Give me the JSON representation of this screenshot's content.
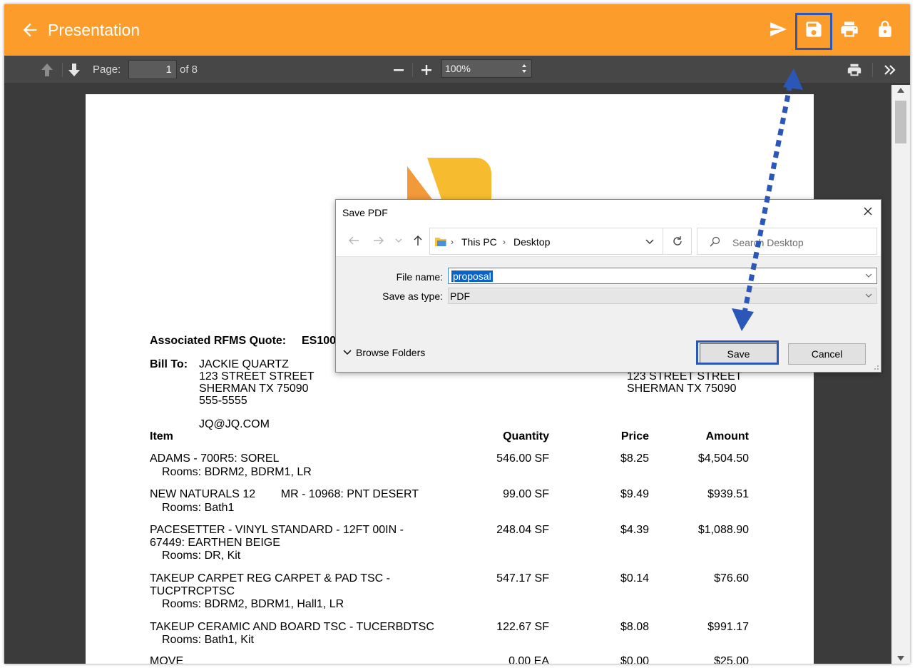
{
  "app": {
    "title": "Presentation",
    "accent_color": "#fc9c2b",
    "header_icons": [
      "send-icon",
      "save-icon",
      "print-icon",
      "lock-icon"
    ]
  },
  "pdf_toolbar": {
    "page_label": "Page:",
    "page_value": "1",
    "page_count": "of 8",
    "zoom_value": "100%"
  },
  "document": {
    "quote_label": "Associated RFMS Quote:",
    "quote_number_partial": "ES100",
    "bill_to_label": "Bill To:",
    "bill_to": [
      "JACKIE QUARTZ",
      "123 STREET STREET",
      "SHERMAN TX 75090",
      "555-5555",
      "",
      "JQ@JQ.COM"
    ],
    "ship_to": [
      "123 STREET STREET",
      "SHERMAN TX 75090"
    ],
    "columns": {
      "item": "Item",
      "quantity": "Quantity",
      "price": "Price",
      "amount": "Amount"
    },
    "rows": [
      {
        "item": [
          "ADAMS - 700R5: SOREL"
        ],
        "rooms": "Rooms: BDRM2, BDRM1, LR",
        "quantity": "546.00 SF",
        "price": "$8.25",
        "amount": "$4,504.50"
      },
      {
        "item": [
          "NEW NATURALS 12        MR - 10968: PNT DESERT"
        ],
        "rooms": "Rooms: Bath1",
        "quantity": "99.00 SF",
        "price": "$9.49",
        "amount": "$939.51"
      },
      {
        "item": [
          "PACESETTER - VINYL STANDARD - 12FT 00IN -",
          "67449: EARTHEN BEIGE"
        ],
        "rooms": "Rooms: DR, Kit",
        "quantity": "248.04 SF",
        "price": "$4.39",
        "amount": "$1,088.90"
      },
      {
        "item": [
          "TAKEUP CARPET REG CARPET & PAD TSC -",
          "TUCPTRCPTSC"
        ],
        "rooms": "Rooms: BDRM2, BDRM1, Hall1, LR",
        "quantity": "547.17 SF",
        "price": "$0.14",
        "amount": "$76.60"
      },
      {
        "item": [
          "TAKEUP CERAMIC AND BOARD TSC - TUCERBDTSC"
        ],
        "rooms": "Rooms: Bath1, Kit",
        "quantity": "122.67 SF",
        "price": "$8.08",
        "amount": "$991.17"
      },
      {
        "item": [
          "MOVE"
        ],
        "rooms": "",
        "quantity": "0.00 EA",
        "price": "$0.00",
        "amount": "$25.00"
      }
    ]
  },
  "save_dialog": {
    "title": "Save PDF",
    "breadcrumb": [
      "This PC",
      "Desktop"
    ],
    "search_placeholder": "Search Desktop",
    "file_name_label": "File name:",
    "file_name_value": "proposal",
    "save_type_label": "Save as type:",
    "save_type_value": "PDF",
    "browse_folders": "Browse Folders",
    "save_label": "Save",
    "cancel_label": "Cancel"
  },
  "annotation_color": "#2a57b8"
}
